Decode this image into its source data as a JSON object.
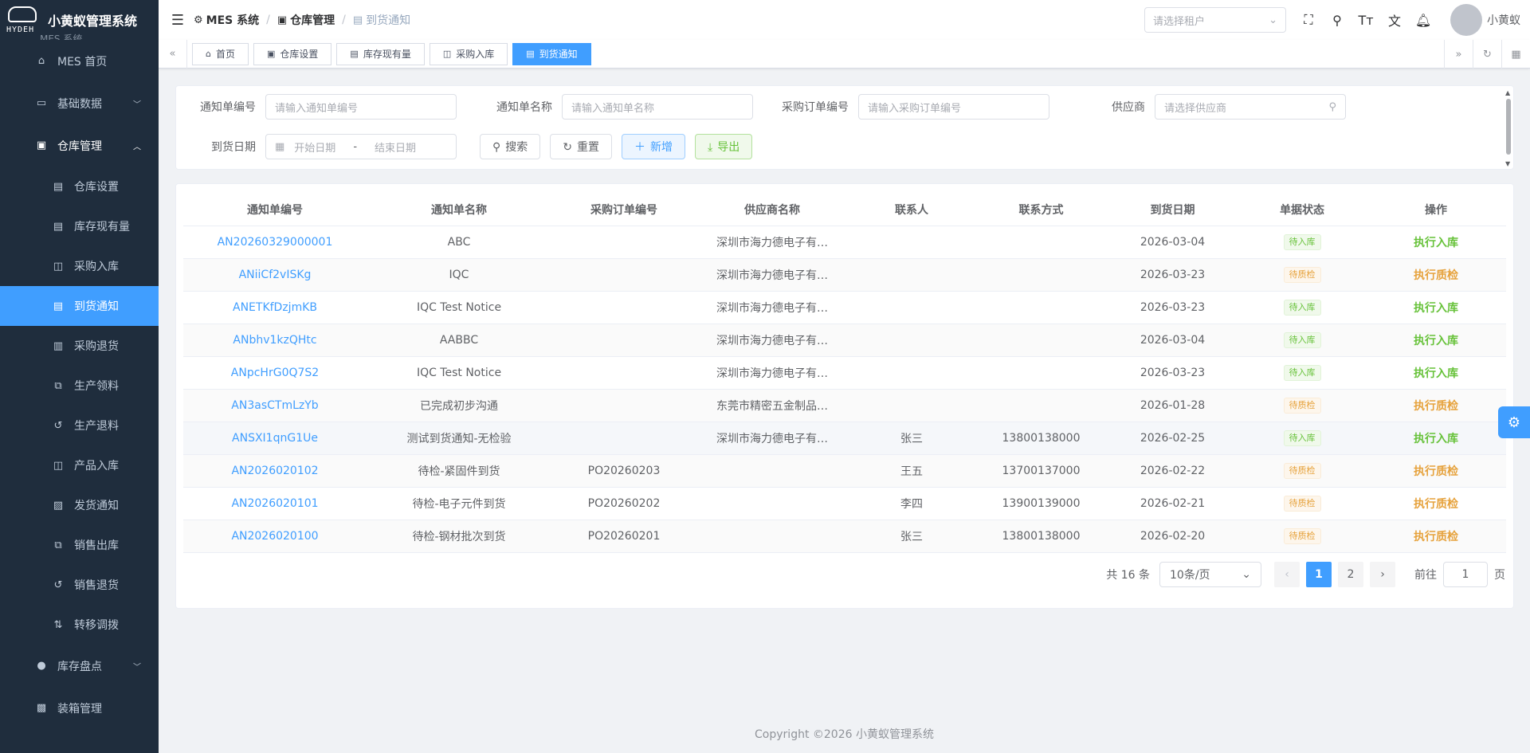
{
  "app": {
    "title": "小黄蚁管理系统",
    "logo_text": "HYDEH",
    "subtitle": "MES 系统"
  },
  "sidebar": {
    "items": [
      {
        "label": "MES 首页",
        "icon": "home-icon",
        "level": "top"
      },
      {
        "label": "基础数据",
        "icon": "monitor-icon",
        "level": "top",
        "arrow": "down"
      },
      {
        "label": "仓库管理",
        "icon": "warehouse-icon",
        "level": "top",
        "arrow": "up"
      },
      {
        "label": "仓库设置",
        "icon": "document-icon",
        "level": "sub"
      },
      {
        "label": "库存现有量",
        "icon": "document-icon",
        "level": "sub"
      },
      {
        "label": "采购入库",
        "icon": "bag-icon",
        "level": "sub"
      },
      {
        "label": "到货通知",
        "icon": "document-icon",
        "level": "sub",
        "active": true
      },
      {
        "label": "采购退货",
        "icon": "wallet-icon",
        "level": "sub"
      },
      {
        "label": "生产领料",
        "icon": "box-icon",
        "level": "sub"
      },
      {
        "label": "生产退料",
        "icon": "refresh-icon",
        "level": "sub"
      },
      {
        "label": "产品入库",
        "icon": "bag-icon",
        "level": "sub"
      },
      {
        "label": "发货通知",
        "icon": "clipboard-icon",
        "level": "sub"
      },
      {
        "label": "销售出库",
        "icon": "box-icon",
        "level": "sub"
      },
      {
        "label": "销售退货",
        "icon": "refresh-icon",
        "level": "sub"
      },
      {
        "label": "转移调拨",
        "icon": "sort-icon",
        "level": "sub"
      },
      {
        "label": "库存盘点",
        "icon": "check-circle-icon",
        "level": "top",
        "arrow": "down"
      },
      {
        "label": "装箱管理",
        "icon": "package-icon",
        "level": "top"
      }
    ]
  },
  "navbar": {
    "breadcrumb": [
      {
        "label": "MES 系统",
        "icon": "chip-icon"
      },
      {
        "label": "仓库管理",
        "icon": "warehouse-icon"
      },
      {
        "label": "到货通知",
        "icon": "document-icon"
      }
    ],
    "tenant_placeholder": "请选择租户",
    "username": "小黄蚁"
  },
  "tags": [
    {
      "label": "首页",
      "icon": "home-icon"
    },
    {
      "label": "仓库设置",
      "icon": "warehouse-icon"
    },
    {
      "label": "库存现有量",
      "icon": "document-icon"
    },
    {
      "label": "采购入库",
      "icon": "bag-icon"
    },
    {
      "label": "到货通知",
      "icon": "document-icon",
      "active": true
    }
  ],
  "search": {
    "notice_code_label": "通知单编号",
    "notice_code_placeholder": "请输入通知单编号",
    "notice_name_label": "通知单名称",
    "notice_name_placeholder": "请输入通知单名称",
    "po_code_label": "采购订单编号",
    "po_code_placeholder": "请输入采购订单编号",
    "vendor_label": "供应商",
    "vendor_placeholder": "请选择供应商",
    "date_label": "到货日期",
    "date_start_placeholder": "开始日期",
    "date_sep": "-",
    "date_end_placeholder": "结束日期",
    "search_btn": "搜索",
    "reset_btn": "重置",
    "add_btn": "新增",
    "export_btn": "导出"
  },
  "table": {
    "columns": [
      "通知单编号",
      "通知单名称",
      "采购订单编号",
      "供应商名称",
      "联系人",
      "联系方式",
      "到货日期",
      "单据状态",
      "操作"
    ],
    "rows": [
      {
        "code": "AN20260329000001",
        "name": "ABC",
        "po": "",
        "vendor": "深圳市海力德电子有…",
        "contact": "",
        "phone": "",
        "date": "2026-03-04",
        "status": "待入库",
        "status_type": "in",
        "op": "执行入库"
      },
      {
        "code": "ANiiCf2vISKg",
        "name": "IQC",
        "po": "",
        "vendor": "深圳市海力德电子有…",
        "contact": "",
        "phone": "",
        "date": "2026-03-23",
        "status": "待质检",
        "status_type": "qc",
        "op": "执行质检"
      },
      {
        "code": "ANETKfDzjmKB",
        "name": "IQC Test Notice",
        "po": "",
        "vendor": "深圳市海力德电子有…",
        "contact": "",
        "phone": "",
        "date": "2026-03-23",
        "status": "待入库",
        "status_type": "in",
        "op": "执行入库"
      },
      {
        "code": "ANbhv1kzQHtc",
        "name": "AABBC",
        "po": "",
        "vendor": "深圳市海力德电子有…",
        "contact": "",
        "phone": "",
        "date": "2026-03-04",
        "status": "待入库",
        "status_type": "in",
        "op": "执行入库"
      },
      {
        "code": "ANpcHrG0Q7S2",
        "name": "IQC Test Notice",
        "po": "",
        "vendor": "深圳市海力德电子有…",
        "contact": "",
        "phone": "",
        "date": "2026-03-23",
        "status": "待入库",
        "status_type": "in",
        "op": "执行入库"
      },
      {
        "code": "AN3asCTmLzYb",
        "name": "已完成初步沟通",
        "po": "",
        "vendor": "东莞市精密五金制品…",
        "contact": "",
        "phone": "",
        "date": "2026-01-28",
        "status": "待质检",
        "status_type": "qc",
        "op": "执行质检"
      },
      {
        "code": "ANSXI1qnG1Ue",
        "name": "测试到货通知-无检验",
        "po": "",
        "vendor": "深圳市海力德电子有…",
        "contact": "张三",
        "phone": "13800138000",
        "date": "2026-02-25",
        "status": "待入库",
        "status_type": "in",
        "op": "执行入库"
      },
      {
        "code": "AN2026020102",
        "name": "待检-紧固件到货",
        "po": "PO20260203",
        "vendor": "",
        "contact": "王五",
        "phone": "13700137000",
        "date": "2026-02-22",
        "status": "待质检",
        "status_type": "qc",
        "op": "执行质检"
      },
      {
        "code": "AN2026020101",
        "name": "待检-电子元件到货",
        "po": "PO20260202",
        "vendor": "",
        "contact": "李四",
        "phone": "13900139000",
        "date": "2026-02-21",
        "status": "待质检",
        "status_type": "qc",
        "op": "执行质检"
      },
      {
        "code": "AN2026020100",
        "name": "待检-钢材批次到货",
        "po": "PO20260201",
        "vendor": "",
        "contact": "张三",
        "phone": "13800138000",
        "date": "2026-02-20",
        "status": "待质检",
        "status_type": "qc",
        "op": "执行质检"
      }
    ]
  },
  "pagination": {
    "total_text": "共 16 条",
    "page_size": "10条/页",
    "pages": [
      "1",
      "2"
    ],
    "current": "1",
    "goto_label": "前往",
    "goto_value": "1",
    "page_suffix": "页"
  },
  "footer": {
    "copyright": "Copyright ©2026 小黄蚁管理系统"
  },
  "colors": {
    "primary": "#409eff",
    "success": "#67c23a",
    "warning": "#e6a23c",
    "sidebar_bg": "#1f2d3d"
  }
}
